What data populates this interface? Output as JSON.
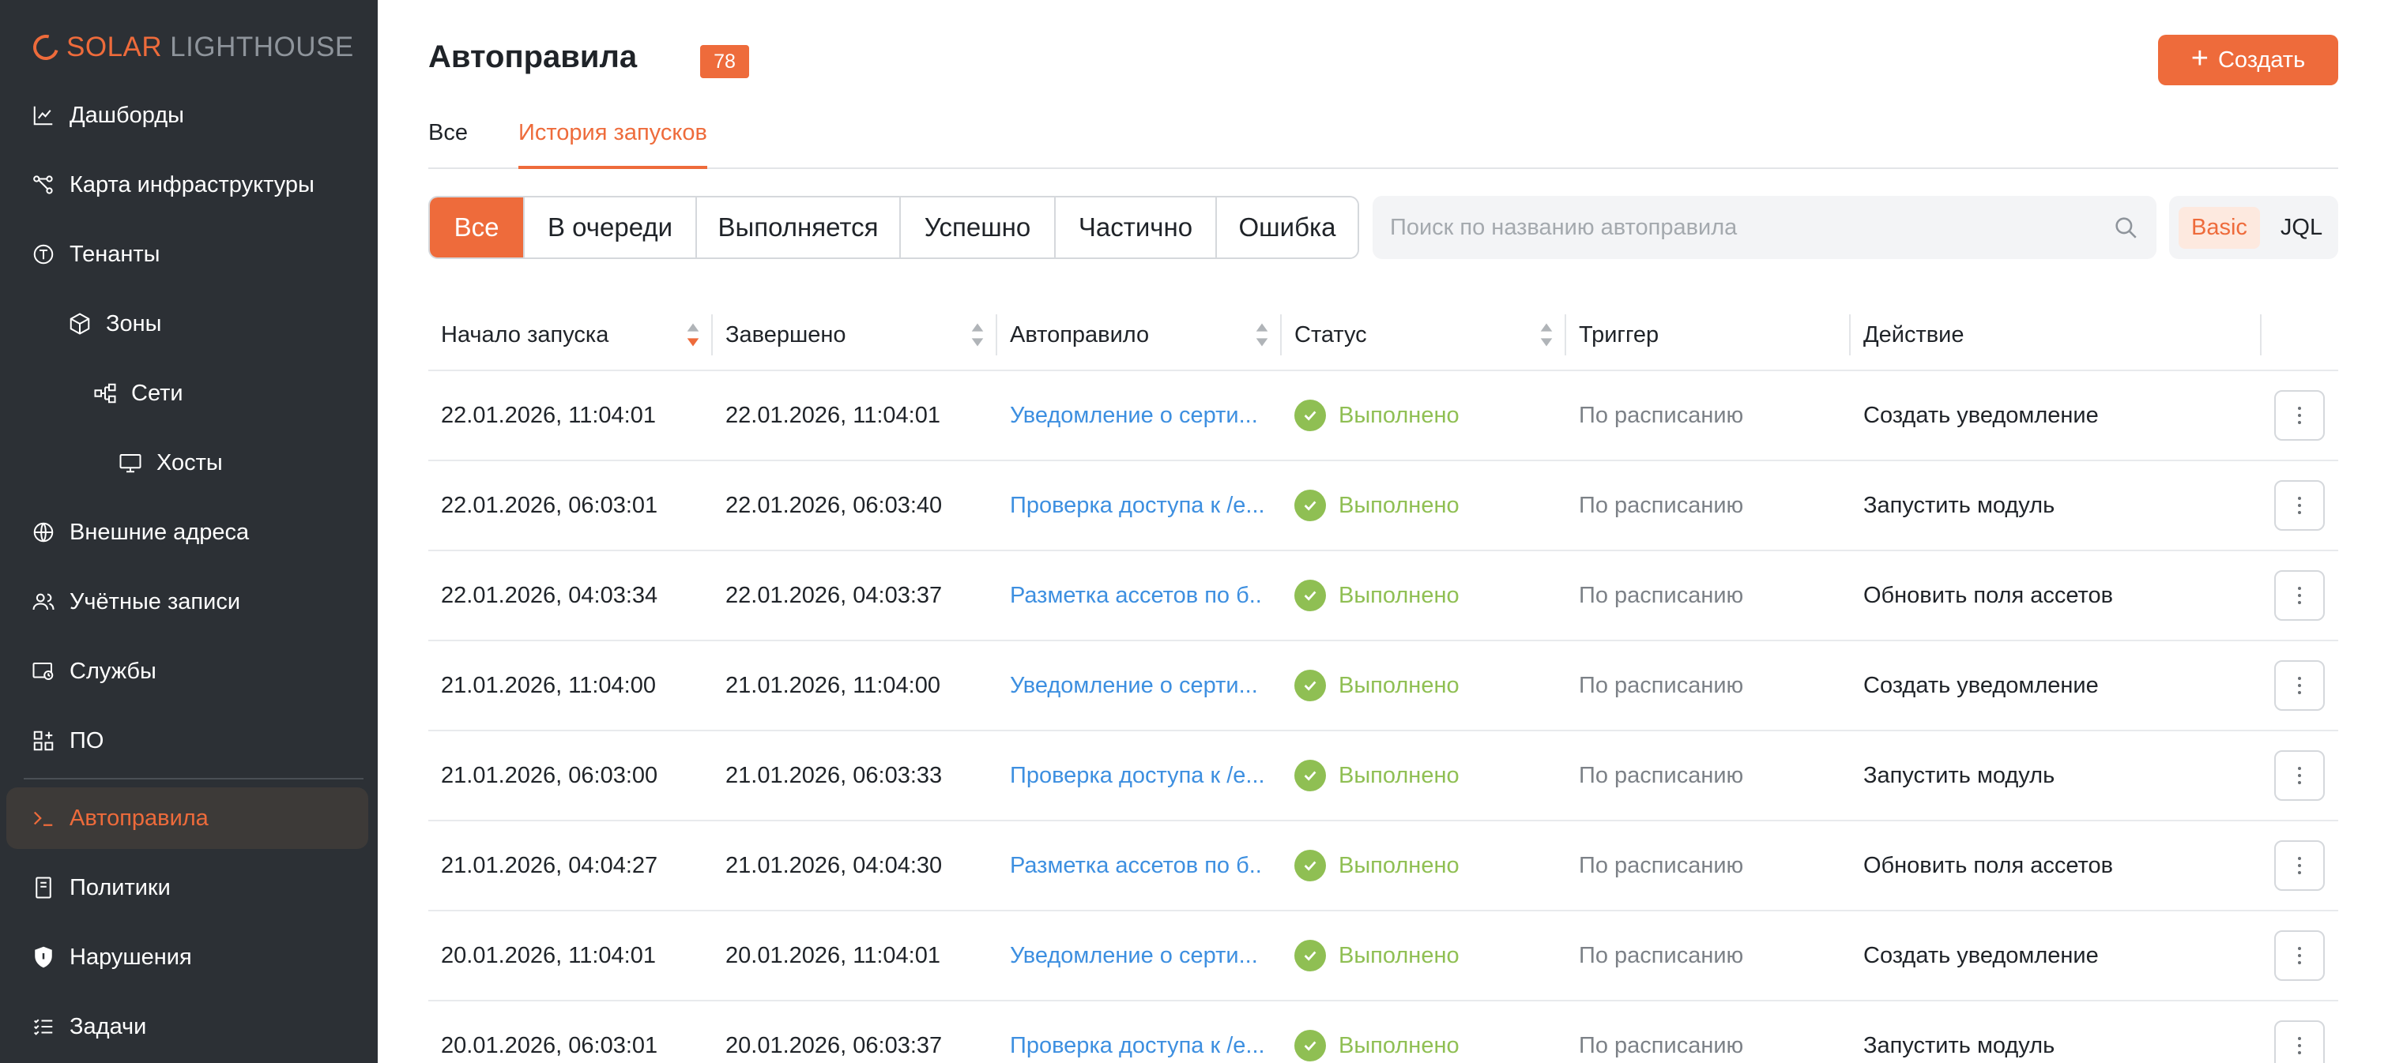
{
  "brand": {
    "name_primary": "SOLAR",
    "name_secondary": "LIGHTHOUSE",
    "accent": "#ee6b3b"
  },
  "sidebar": {
    "items": [
      {
        "label": "Дашборды",
        "icon": "chart-icon"
      },
      {
        "label": "Карта инфраструктуры",
        "icon": "network-map-icon"
      },
      {
        "label": "Тенанты",
        "icon": "tenant-icon"
      },
      {
        "label": "Зоны",
        "icon": "cube-icon"
      },
      {
        "label": "Сети",
        "icon": "network-icon"
      },
      {
        "label": "Хосты",
        "icon": "monitor-icon"
      },
      {
        "label": "Внешние адреса",
        "icon": "globe-icon"
      },
      {
        "label": "Учётные записи",
        "icon": "users-icon"
      },
      {
        "label": "Службы",
        "icon": "service-icon"
      },
      {
        "label": "ПО",
        "icon": "apps-icon"
      },
      {
        "label": "Автоправила",
        "icon": "terminal-icon",
        "active": true
      },
      {
        "label": "Политики",
        "icon": "document-icon"
      },
      {
        "label": "Нарушения",
        "icon": "shield-icon"
      },
      {
        "label": "Задачи",
        "icon": "task-list-icon"
      }
    ]
  },
  "header": {
    "title": "Автоправила",
    "count": "78",
    "create_label": "Создать"
  },
  "tabs": [
    {
      "label": "Все",
      "active": false
    },
    {
      "label": "История запусков",
      "active": true
    }
  ],
  "filters": [
    {
      "label": "Все",
      "active": true
    },
    {
      "label": "В очереди"
    },
    {
      "label": "Выполняется"
    },
    {
      "label": "Успешно"
    },
    {
      "label": "Частично"
    },
    {
      "label": "Ошибка"
    }
  ],
  "search": {
    "placeholder": "Поиск по названию автоправила",
    "value": ""
  },
  "mode": {
    "basic": "Basic",
    "jql": "JQL",
    "selected": "Basic"
  },
  "table": {
    "columns": [
      "Начало запуска",
      "Завершено",
      "Автоправило",
      "Статус",
      "Триггер",
      "Действие"
    ],
    "rows": [
      {
        "start": "22.01.2026, 11:04:01",
        "end": "22.01.2026, 11:04:01",
        "rule": "Уведомление о серти...",
        "status": "Выполнено",
        "trigger": "По расписанию",
        "action": "Создать уведомление"
      },
      {
        "start": "22.01.2026, 06:03:01",
        "end": "22.01.2026, 06:03:40",
        "rule": "Проверка доступа к /е...",
        "status": "Выполнено",
        "trigger": "По расписанию",
        "action": "Запустить модуль"
      },
      {
        "start": "22.01.2026, 04:03:34",
        "end": "22.01.2026, 04:03:37",
        "rule": "Разметка ассетов по б...",
        "status": "Выполнено",
        "trigger": "По расписанию",
        "action": "Обновить поля ассетов"
      },
      {
        "start": "21.01.2026, 11:04:00",
        "end": "21.01.2026, 11:04:00",
        "rule": "Уведомление о серти...",
        "status": "Выполнено",
        "trigger": "По расписанию",
        "action": "Создать уведомление"
      },
      {
        "start": "21.01.2026, 06:03:00",
        "end": "21.01.2026, 06:03:33",
        "rule": "Проверка доступа к /е...",
        "status": "Выполнено",
        "trigger": "По расписанию",
        "action": "Запустить модуль"
      },
      {
        "start": "21.01.2026, 04:04:27",
        "end": "21.01.2026, 04:04:30",
        "rule": "Разметка ассетов по б...",
        "status": "Выполнено",
        "trigger": "По расписанию",
        "action": "Обновить поля ассетов"
      },
      {
        "start": "20.01.2026, 11:04:01",
        "end": "20.01.2026, 11:04:01",
        "rule": "Уведомление о серти...",
        "status": "Выполнено",
        "trigger": "По расписанию",
        "action": "Создать уведомление"
      },
      {
        "start": "20.01.2026, 06:03:01",
        "end": "20.01.2026, 06:03:37",
        "rule": "Проверка доступа к /е...",
        "status": "Выполнено",
        "trigger": "По расписанию",
        "action": "Запустить модуль"
      }
    ]
  }
}
